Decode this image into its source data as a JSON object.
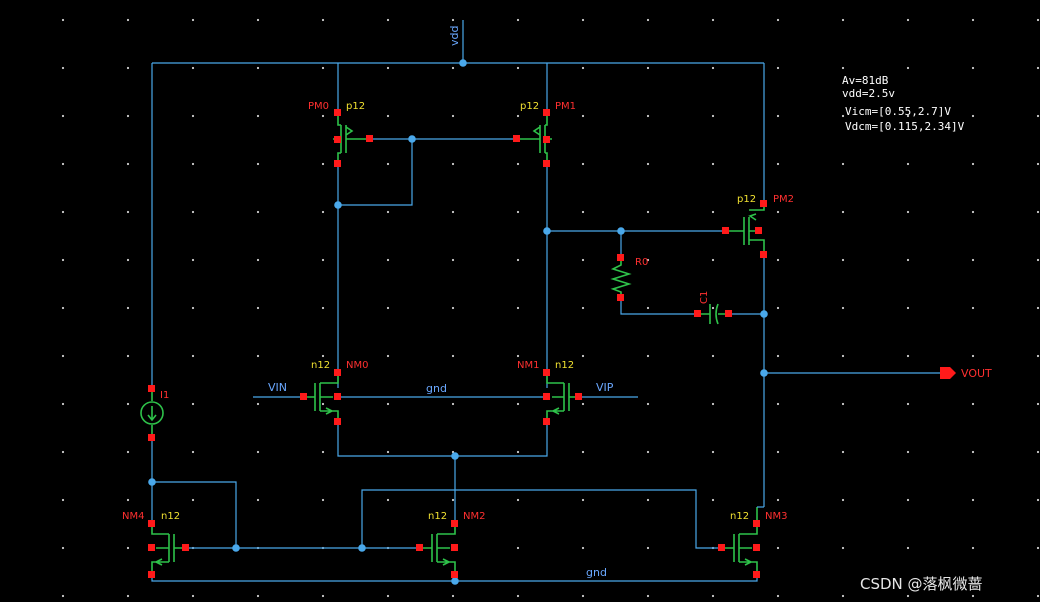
{
  "annotations": {
    "gain": "Av=81dB",
    "supply": "vdd=2.5v",
    "vicm": "Vicm=[0.55,2.7]V",
    "vdcm": "Vdcm=[0.115,2.34]V"
  },
  "nets": {
    "vdd": "vdd",
    "gnd": "gnd",
    "vin": "VIN",
    "vip": "VIP",
    "vout": "VOUT"
  },
  "devices": {
    "pm0": {
      "name": "PM0",
      "model": "p12"
    },
    "pm1": {
      "name": "PM1",
      "model": "p12"
    },
    "pm2": {
      "name": "PM2",
      "model": "p12"
    },
    "nm0": {
      "name": "NM0",
      "model": "n12"
    },
    "nm1": {
      "name": "NM1",
      "model": "n12"
    },
    "nm2": {
      "name": "NM2",
      "model": "n12"
    },
    "nm3": {
      "name": "NM3",
      "model": "n12"
    },
    "nm4": {
      "name": "NM4",
      "model": "n12"
    },
    "r0": {
      "name": "R0"
    },
    "c1": {
      "name": "C1"
    },
    "i1": {
      "name": "I1"
    }
  },
  "watermark": "CSDN @落枫微蔷",
  "colors": {
    "background": "#000000",
    "wire": "#4aa8ea",
    "device": "#2ec24a",
    "pin": "#ff1a1a",
    "instance_name": "#ff3030",
    "model_name": "#f0e030",
    "net_label": "#6aa8ff"
  }
}
